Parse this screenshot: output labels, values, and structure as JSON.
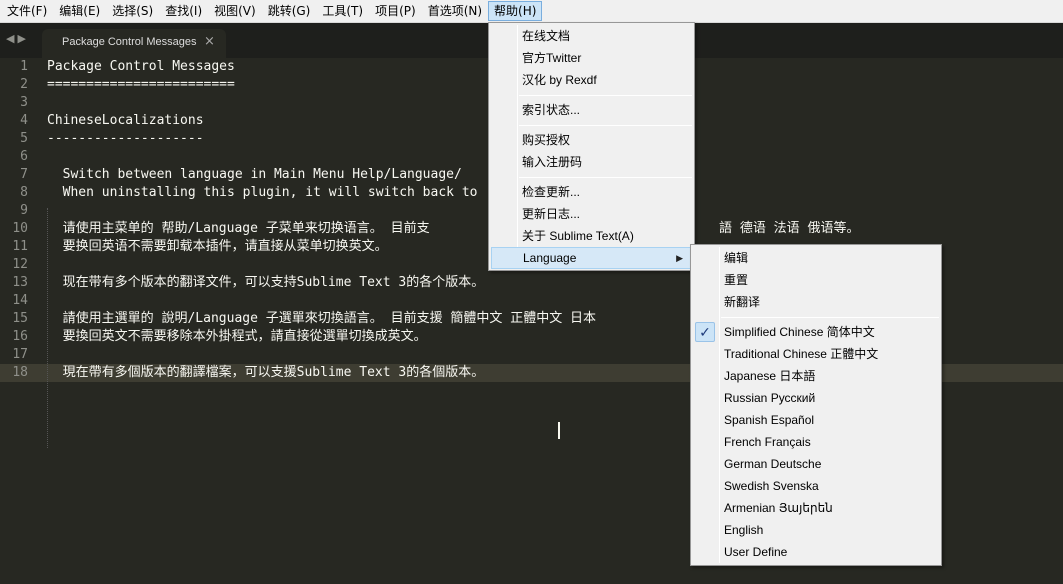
{
  "menubar": {
    "items": [
      "文件(F)",
      "编辑(E)",
      "选择(S)",
      "查找(I)",
      "视图(V)",
      "跳转(G)",
      "工具(T)",
      "项目(P)",
      "首选项(N)",
      "帮助(H)"
    ]
  },
  "tab": {
    "title": "Package Control Messages",
    "close": "×"
  },
  "editor": {
    "lines": [
      "Package Control Messages",
      "========================",
      "",
      "ChineseLocalizations",
      "--------------------",
      "",
      "  Switch between language in Main Menu Help/Language/",
      "  When uninstalling this plugin, it will switch back to",
      "",
      "  请使用主菜单的 帮助/Language 子菜单来切换语言。 目前支",
      "  要换回英语不需要卸载本插件，请直接从菜单切换英文。",
      "",
      "  现在带有多个版本的翻译文件，可以支持Sublime Text 3的各个版本。",
      "",
      "  請使用主選單的 說明/Language 子選單來切換語言。 目前支援 簡體中文 正體中文 日本",
      "  要換回英文不需要移除本外掛程式，請直接從選單切換成英文。",
      "",
      "  現在帶有多個版本的翻譯檔案，可以支援Sublime Text 3的各個版本。"
    ],
    "peek_text": "語 德语 法语 俄语等。"
  },
  "help_menu": {
    "group1": [
      "在线文档",
      "官方Twitter",
      "汉化 by Rexdf"
    ],
    "group2": [
      "索引状态..."
    ],
    "group3": [
      "购买授权",
      "输入注册码"
    ],
    "group4": [
      "检查更新...",
      "更新日志...",
      "关于 Sublime Text(A)"
    ],
    "language": "Language"
  },
  "language_menu": {
    "top": [
      "编辑",
      "重置",
      "新翻译"
    ],
    "languages": [
      "Simplified Chinese 简体中文",
      "Traditional Chinese 正體中文",
      "Japanese 日本語",
      "Russian Русский",
      "Spanish Español",
      "French Français",
      "German Deutsche",
      "Swedish Svenska",
      "Armenian Յայերեն",
      "English",
      "User Define"
    ],
    "checked": "Simplified Chinese 简体中文"
  },
  "colors": {
    "editor_bg": "#272822",
    "text": "#f8f8f2",
    "line_number": "#8f908a"
  }
}
